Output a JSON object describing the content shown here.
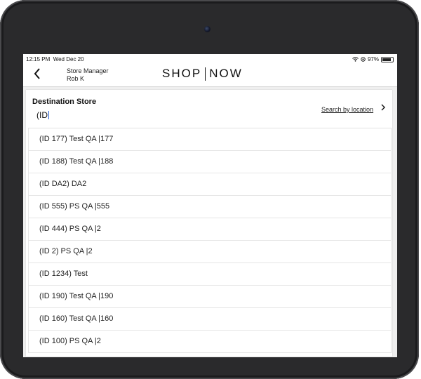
{
  "status": {
    "time": "12:15 PM",
    "date": "Wed Dec 20",
    "battery": "97%"
  },
  "header": {
    "back_icon": "chevron-left-icon",
    "role": "Store Manager",
    "user": "Rob K",
    "brand_left": "SHOP",
    "brand_right": "NOW"
  },
  "destination": {
    "title": "Destination Store",
    "input_value": "(ID",
    "search_link": "Search by location"
  },
  "results": [
    "(ID 177) Test QA |177",
    "(ID 188) Test QA |188",
    "(ID DA2) DA2",
    "(ID 555) PS QA |555",
    "(ID 444) PS QA |2",
    "(ID 2) PS QA |2",
    "(ID 1234) Test",
    "(ID 190) Test QA |190",
    "(ID 160) Test QA |160",
    "(ID 100) PS QA |2"
  ]
}
